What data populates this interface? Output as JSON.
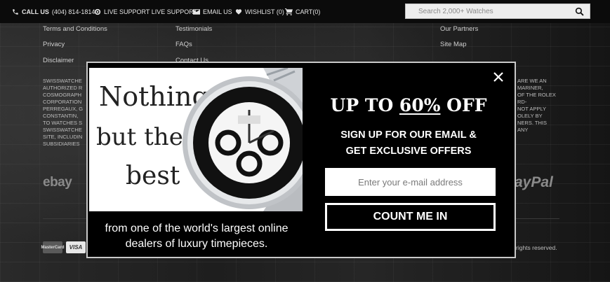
{
  "topbar": {
    "call_label": "CALL US",
    "phone": "(404) 814-1814",
    "live_support": "LIVE SUPPORT LIVE SUPPORT",
    "email_us": "EMAIL US",
    "wishlist": "WISHLIST (0)",
    "cart": "CART(0)",
    "search_placeholder": "Search 2,000+ Watches"
  },
  "footer": {
    "col1": [
      "Terms and Conditions",
      "Privacy",
      "Disclaimer"
    ],
    "col2": [
      "Testimonials",
      "FAQs",
      "Contact Us"
    ],
    "col3": [
      "Our Partners",
      "Site Map"
    ],
    "disclaimer_left": [
      "SWISSWATCHE",
      "AUTHORIZED R",
      "COSMOGRAPH",
      "CORPORATION",
      "PERREGAUX, G",
      "CONSTANTIN,",
      "TO WATCHES S",
      "SWISSWATCHE",
      "SITE, INCLUDIN",
      "SUBSIDIARIES"
    ],
    "disclaimer_right": [
      "ARE WE AN",
      "MARINER,",
      "OF THE ROLEX",
      "RD-",
      "",
      "NOT APPLY",
      "OLELY BY",
      "NERS. THIS",
      "ANY"
    ],
    "ebay": "ebay",
    "paypal": "ayPal",
    "mastercard": "MasterCard",
    "visa": "VISA",
    "copyright": "rights reserved."
  },
  "popup": {
    "image_text": [
      "Nothing",
      "but the",
      "best"
    ],
    "caption": "from one of the world's largest online dealers of luxury timepieces.",
    "headline_prefix": "UP TO ",
    "headline_percent": "60%",
    "headline_suffix": " OFF",
    "subheadline_line1": "SIGN UP FOR OUR EMAIL &",
    "subheadline_line2": "GET EXCLUSIVE OFFERS",
    "email_placeholder": "Enter your e-mail address",
    "cta_label": "COUNT ME IN"
  },
  "colors": {
    "popup_bg": "#000000",
    "popup_border": "#c9c9c9",
    "topbar_bg": "#0b0b0b",
    "text_light": "#ffffff"
  },
  "icons": [
    "phone-icon",
    "support-icon",
    "envelope-icon",
    "heart-icon",
    "cart-icon",
    "search-icon",
    "close-icon",
    "watch-image"
  ]
}
